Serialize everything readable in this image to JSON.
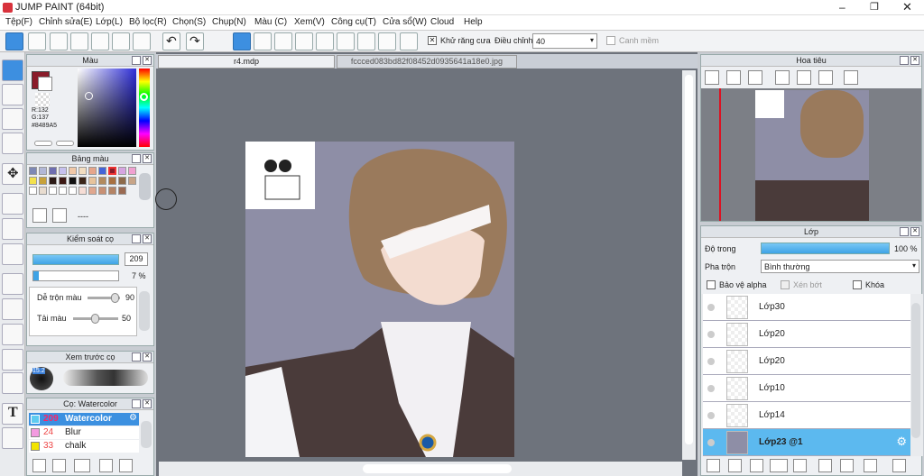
{
  "app": {
    "title": "JUMP PAINT (64bit)"
  },
  "menu": [
    "Tệp(F)",
    "Chỉnh sửa(E)",
    "Lớp(L)",
    "Bộ lọc(R)",
    "Chọn(S)",
    "Chụp(N)",
    "Màu (C)",
    "Xem(V)",
    "Công cụ(T)",
    "Cửa sổ(W)",
    "Cloud",
    "Help"
  ],
  "toolbar": {
    "antialias": "Khử răng cưa",
    "correction": "Điều chỉnh",
    "correction_value": "40",
    "edge": "Canh mềm"
  },
  "tabs": [
    "r4.mdp",
    "fccced083bd82f08452d0935641a18e0.jpg"
  ],
  "color_panel": {
    "title": "Màu",
    "r": "R:132",
    "g": "G:137",
    "hex": "#8489A5"
  },
  "palette": {
    "title": "Bảng màu",
    "dots": "----"
  },
  "brush_control": {
    "title": "Kiểm soát cọ",
    "size": "209",
    "opacity": "7 %",
    "blend_label": "Dễ trộn màu",
    "blend_value": "90",
    "paint_label": "Tải màu",
    "paint_value": "50"
  },
  "preview": {
    "title": "Xem trước cọ",
    "size_badge": "15.2"
  },
  "brushes": {
    "title": "Cọ: Watercolor",
    "items": [
      {
        "size": "209",
        "name": "Watercolor",
        "color": "#5ecbf0"
      },
      {
        "size": "24",
        "name": "Blur",
        "color": "#f39ae0"
      },
      {
        "size": "33",
        "name": "chalk",
        "color": "#f2e400"
      }
    ]
  },
  "navigator": {
    "title": "Hoa tiêu"
  },
  "layers": {
    "title": "Lớp",
    "opacity_label": "Độ trong",
    "opacity_value": "100 %",
    "blend_label": "Pha trộn",
    "blend_value": "Bình thường",
    "protect_alpha": "Bảo vệ alpha",
    "clip": "Xén bớt",
    "lock": "Khóa",
    "items": [
      "Lớp30",
      "Lớp20",
      "Lớp20",
      "Lớp10",
      "Lớp14",
      "Lớp23 @1"
    ]
  }
}
